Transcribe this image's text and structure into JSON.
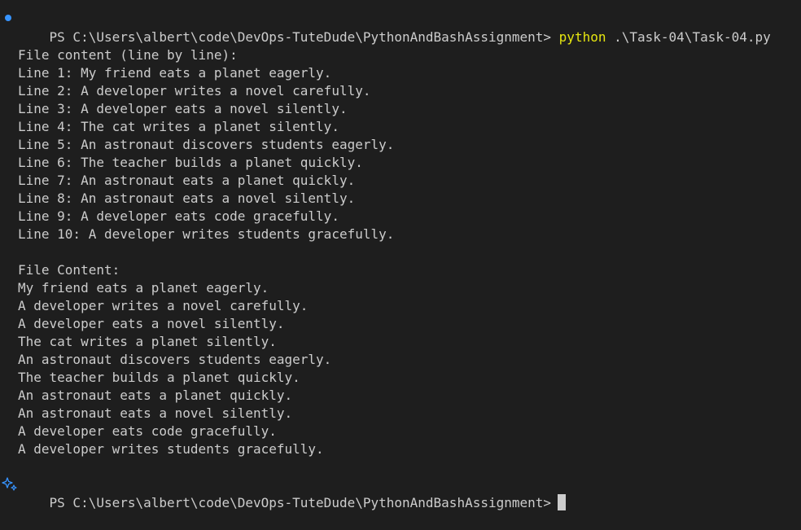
{
  "terminal": {
    "command": {
      "prompt": "PS C:\\Users\\albert\\code\\DevOps-TuteDude\\PythonAndBashAssignment>",
      "program": "python",
      "args": ".\\Task-04\\Task-04.py"
    },
    "section1": {
      "heading": "File content (line by line):",
      "lines": [
        "Line 1: My friend eats a planet eagerly.",
        "Line 2: A developer writes a novel carefully.",
        "Line 3: A developer eats a novel silently.",
        "Line 4: The cat writes a planet silently.",
        "Line 5: An astronaut discovers students eagerly.",
        "Line 6: The teacher builds a planet quickly.",
        "Line 7: An astronaut eats a planet quickly.",
        "Line 8: An astronaut eats a novel silently.",
        "Line 9: A developer eats code gracefully.",
        "Line 10: A developer writes students gracefully."
      ]
    },
    "section2": {
      "heading": "File Content:",
      "lines": [
        "My friend eats a planet eagerly.",
        "A developer writes a novel carefully.",
        "A developer eats a novel silently.",
        "The cat writes a planet silently.",
        "An astronaut discovers students eagerly.",
        "The teacher builds a planet quickly.",
        "An astronaut eats a planet quickly.",
        "An astronaut eats a novel silently.",
        "A developer eats code gracefully.",
        "A developer writes students gracefully."
      ]
    },
    "final_prompt": "PS C:\\Users\\albert\\code\\DevOps-TuteDude\\PythonAndBashAssignment>",
    "colors": {
      "background": "#1e1e1e",
      "text": "#cccccc",
      "command_highlight": "#e5e510",
      "decoration_dot": "#3794ff"
    },
    "icons": {
      "decoration": "command-success-dot",
      "sparkle": "sparkle-icon"
    }
  }
}
